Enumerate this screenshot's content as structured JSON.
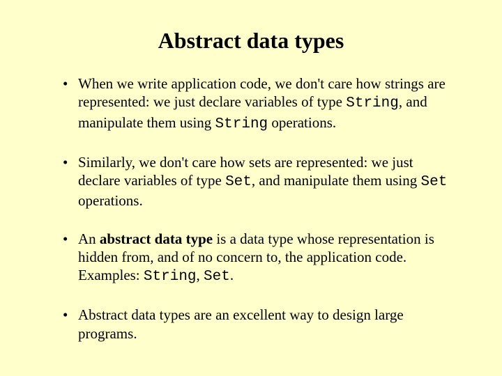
{
  "title": "Abstract data types",
  "bullets": [
    {
      "pre": "When we write application code, we don't care how strings are represented: we just declare variables of type ",
      "code1": "String",
      "mid": ", and manipulate them using ",
      "code2": "String",
      "post": " operations."
    },
    {
      "pre": "Similarly, we don't care how sets are represented: we just declare variables of type ",
      "code1": "Set",
      "mid": ", and manipulate them using ",
      "code2": "Set",
      "post": " operations."
    },
    {
      "pre": "An ",
      "bold": "abstract data type",
      "mid1": " is a data type whose representation is hidden from, and of no concern to, the application code. Examples: ",
      "code1": "String",
      "sep": ", ",
      "code2": "Set",
      "post": "."
    },
    {
      "text": "Abstract data types are an excellent way to design large programs."
    }
  ]
}
